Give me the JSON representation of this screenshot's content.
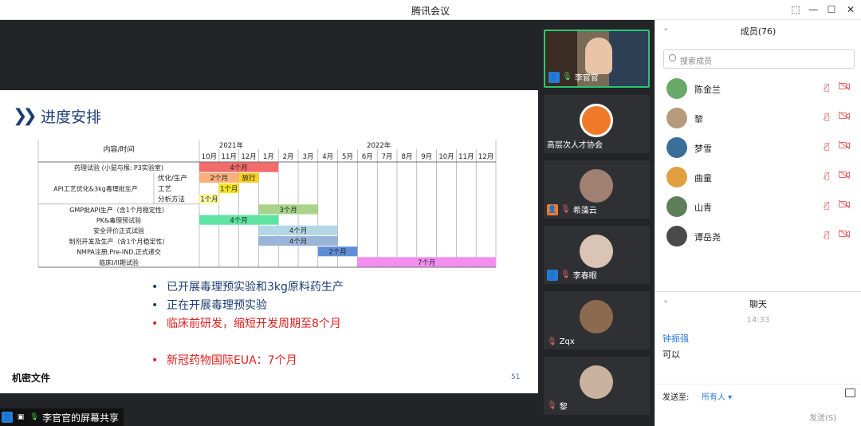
{
  "window": {
    "title": "腾讯会议"
  },
  "share": {
    "slide_title": "进度安排",
    "bullets": [
      {
        "text": "已开展毒理预实验和3kg原料药生产",
        "style": "blue"
      },
      {
        "text": "正在开展毒理预实验",
        "style": "blue"
      },
      {
        "text": "临床前研发，缩短开发周期至8个月",
        "style": "red"
      },
      {
        "text": "",
        "style": "spacer"
      },
      {
        "text": "新冠药物国际EUA：7个月",
        "style": "red"
      }
    ],
    "confidential": "机密文件",
    "page_number": "51",
    "share_label": "李官官的屏幕共享"
  },
  "gantt": {
    "header_label": "内容/时间",
    "years": [
      "2021年",
      "2022年"
    ],
    "months": [
      "10月",
      "11月",
      "12月",
      "1月",
      "2月",
      "3月",
      "4月",
      "5月",
      "6月",
      "7月",
      "8月",
      "9月",
      "10月",
      "11月",
      "12月"
    ],
    "rows": [
      {
        "label": "药理试验 (小鼠与猴: P3实验室)"
      },
      {
        "label": "API工艺优化&3kg毒理批生产",
        "sub": [
          "优化/生产",
          "工艺",
          "分析方法"
        ]
      },
      {
        "label": "GMP批API生产（含1个月稳定性）"
      },
      {
        "label": "PK&毒理预试验"
      },
      {
        "label": "安全评价正式试验"
      },
      {
        "label": "制剂开发及生产（含1个月稳定性）"
      },
      {
        "label": "NMPA注册,Pre-IND,正式递交"
      },
      {
        "label": "临床I/II期试验"
      }
    ],
    "bars": [
      {
        "row": 0,
        "start": 0,
        "span": 4,
        "label": "4个月",
        "color": "#f26b6b"
      },
      {
        "row": 1,
        "start": 0,
        "span": 2,
        "label": "2个月",
        "color": "#f6b07b"
      },
      {
        "row": 1,
        "start": 2,
        "span": 1,
        "label": "放行",
        "color": "#f5d020"
      },
      {
        "row": 2,
        "start": 1,
        "span": 1,
        "label": "1个月",
        "color": "#f5e61b"
      },
      {
        "row": 3,
        "start": 0,
        "span": 1,
        "label": "1个月",
        "color": "#fffaa0"
      },
      {
        "row": 4,
        "start": 3,
        "span": 3,
        "label": "3个月",
        "color": "#a9d38a"
      },
      {
        "row": 5,
        "start": 0,
        "span": 4,
        "label": "4个月",
        "color": "#5ee3a0"
      },
      {
        "row": 6,
        "start": 3,
        "span": 4,
        "label": "4个月",
        "color": "#b4d7e6"
      },
      {
        "row": 7,
        "start": 3,
        "span": 4,
        "label": "4个月",
        "color": "#9bb5d8"
      },
      {
        "row": 8,
        "start": 6,
        "span": 2,
        "label": "2个月",
        "color": "#5e8fd6"
      },
      {
        "row": 9,
        "start": 8,
        "span": 7,
        "label": "7个月",
        "color": "#f38ef0"
      }
    ]
  },
  "videos": [
    {
      "name": "李官官",
      "type": "camera",
      "active": true
    },
    {
      "name": "高层次人才协会",
      "type": "logo"
    },
    {
      "name": "希藻云",
      "type": "avatar"
    },
    {
      "name": "李春眼",
      "type": "avatar"
    },
    {
      "name": "Zqx",
      "type": "avatar"
    },
    {
      "name": "黎",
      "type": "avatar"
    }
  ],
  "members": {
    "header": "成员(76)",
    "search_placeholder": "搜索成员",
    "list": [
      {
        "name": "陈金兰",
        "color": "#6aa86a"
      },
      {
        "name": "黎",
        "color": "#b59a7c"
      },
      {
        "name": "梦雪",
        "color": "#3a6f9a"
      },
      {
        "name": "曲童",
        "color": "#e0a040"
      },
      {
        "name": "山青",
        "color": "#5e7e5a"
      },
      {
        "name": "谭岳尧",
        "color": "#4a4a4a"
      }
    ]
  },
  "chat": {
    "header": "聊天",
    "time": "14:33",
    "sender": "钟振强",
    "message": "可以",
    "send_to_label": "发送至:",
    "send_to_value": "所有人",
    "send_button": "发送(S)"
  }
}
